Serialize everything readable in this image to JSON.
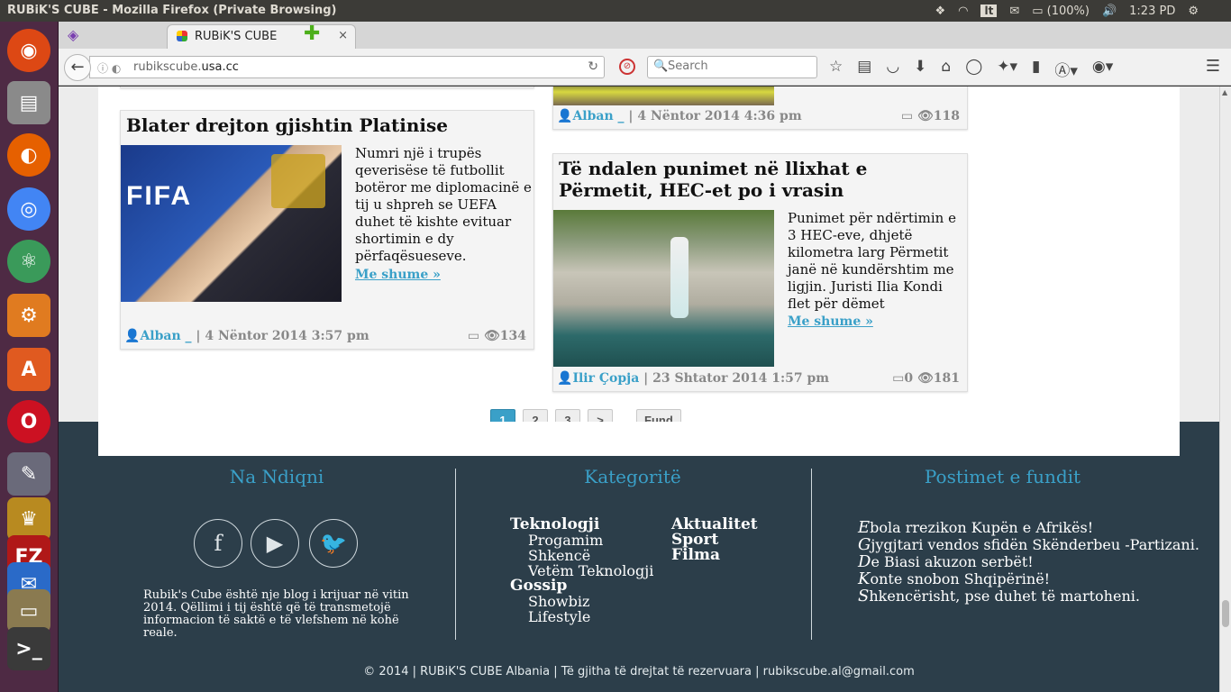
{
  "os": {
    "window_title": "RUBiK'S CUBE - Mozilla Firefox (Private Browsing)",
    "tray": {
      "keyboard": "lt",
      "battery": "(100%)",
      "clock": "1:23 PD"
    }
  },
  "browser": {
    "tab_title": "RUBiK'S CUBE",
    "tab_close": "×",
    "url_prefix": "rubikscube.",
    "url_domain": "usa.cc",
    "search_placeholder": "Search"
  },
  "articles": [
    {
      "title": "Blater drejton gjishtin Platinise",
      "excerpt": "Numri një i trupës qeverisëse të futbollit botëror me diplomacinë e tij u shpreh se UEFA duhet të kishte evituar shortimin e dy përfaqësueseve.",
      "more": "Me shume »",
      "author": "Alban _",
      "date": "| 4 Nëntor 2014 3:57 pm",
      "comments": "",
      "views": "134"
    },
    {
      "title": "",
      "author": "Alban _",
      "date": "| 4 Nëntor 2014 4:36 pm",
      "comments": "",
      "views": "118"
    },
    {
      "title": "Të ndalen punimet në llixhat e Përmetit, HEC-et po i vrasin",
      "excerpt": "Punimet për ndërtimin e 3 HEC-eve, dhjetë kilometra larg Përmetit janë në kundërshtim me ligjin. Juristi Ilia Kondi flet për dëmet",
      "more": "Me shume »",
      "author": "Ilir Çopja",
      "date": "| 23 Shtator 2014 1:57 pm",
      "comments": "0",
      "views": "181"
    }
  ],
  "pagination": [
    "1",
    "2",
    "3",
    ">",
    "Fund"
  ],
  "footer": {
    "follow_title": "Na Ndiqni",
    "categories_title": "Kategoritë",
    "recent_title": "Postimet e fundit",
    "about": "Rubik's Cube është nje blog i krijuar në vitin 2014. Qëllimi i tij është që të transmetojë informacion të saktë e të vlefshem në kohë reale.",
    "categories_left": [
      {
        "label": "Teknologji",
        "type": "cat"
      },
      {
        "label": "Progamim",
        "type": "sub"
      },
      {
        "label": "Shkencë",
        "type": "sub"
      },
      {
        "label": "Vetëm Teknologji",
        "type": "sub"
      },
      {
        "label": "Gossip",
        "type": "cat"
      },
      {
        "label": "Showbiz",
        "type": "sub"
      },
      {
        "label": "Lifestyle",
        "type": "sub"
      }
    ],
    "categories_right": [
      "Aktualitet",
      "Sport",
      "Filma"
    ],
    "recent_posts": [
      "Ebola rrezikon Kupën e Afrikës!",
      "Gjygjtari vendos sfidën Skënderbeu -Partizani.",
      "De Biasi akuzon serbët!",
      "Konte snobon Shqipërinë!",
      "Shkencërisht, pse duhet të martoheni."
    ],
    "copyright": "© 2014 | RUBiK'S CUBE Albania | Të gjitha të drejtat të rezervuara | rubikscube.al@gmail.com"
  }
}
